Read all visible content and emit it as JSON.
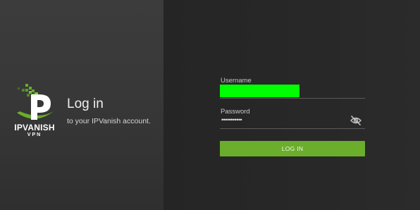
{
  "brand": {
    "name": "IPVANISH",
    "sub": "VPN",
    "accent_color": "#6aae2c"
  },
  "login": {
    "title": "Log in",
    "subtitle": "to your IPVanish account."
  },
  "form": {
    "username_label": "Username",
    "username_value_redacted_color": "#00ff00",
    "password_label": "Password",
    "password_value": "•••••••••••",
    "visibility_icon": "eye-off-icon",
    "submit_label": "LOG IN"
  }
}
